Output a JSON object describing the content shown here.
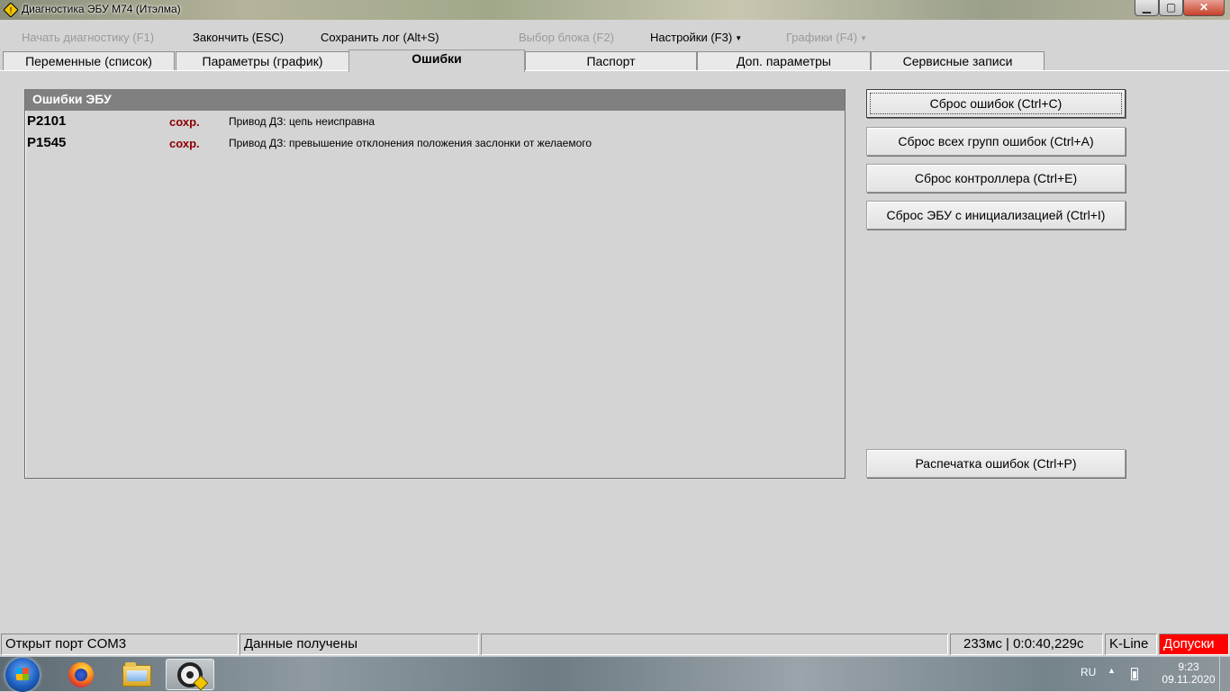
{
  "window": {
    "title": "Диагностика ЭБУ М74 (Итэлма)",
    "controls": {
      "minimize": "▁",
      "maximize": "▢",
      "close": "✕"
    }
  },
  "menu": {
    "start_diag": "Начать диагностику (F1)",
    "finish": "Закончить (ESC)",
    "save_log": "Сохранить лог (Alt+S)",
    "select_block": "Выбор блока (F2)",
    "settings": "Настройки (F3)",
    "graphs": "Графики (F4)"
  },
  "tabs": [
    {
      "label": "Переменные (список)"
    },
    {
      "label": "Параметры (график)"
    },
    {
      "label": "Ошибки"
    },
    {
      "label": "Паспорт"
    },
    {
      "label": "Доп. параметры"
    },
    {
      "label": "Сервисные записи"
    }
  ],
  "active_tab": "Ошибки",
  "errors_panel": {
    "header": "Ошибки ЭБУ",
    "rows": [
      {
        "code": "P2101",
        "status": "сохр.",
        "description": "Привод ДЗ: цепь неисправна"
      },
      {
        "code": "P1545",
        "status": "сохр.",
        "description": "Привод ДЗ: превышение отклонения положения заслонки от желаемого"
      }
    ]
  },
  "buttons": {
    "reset_errors": "Сброс ошибок (Ctrl+C)",
    "reset_all_groups": "Сброс всех групп ошибок (Ctrl+A)",
    "reset_controller": "Сброс контроллера (Ctrl+E)",
    "reset_ecu_init": "Сброс ЭБУ с инициализацией (Ctrl+I)",
    "print_errors": "Распечатка ошибок (Ctrl+P)"
  },
  "statusbar": {
    "port": "Открыт порт COM3",
    "data": "Данные получены",
    "empty": "",
    "timing": "233мс | 0:0:40,229с",
    "protocol": "K-Line",
    "tolerance": "Допуски"
  },
  "taskbar": {
    "language": "RU",
    "time": "9:23",
    "date": "09.11.2020"
  },
  "colors": {
    "panel_header": "#808080",
    "status_text": "#8b0000",
    "alert": "#ff0000",
    "background": "#d4d4d4"
  }
}
